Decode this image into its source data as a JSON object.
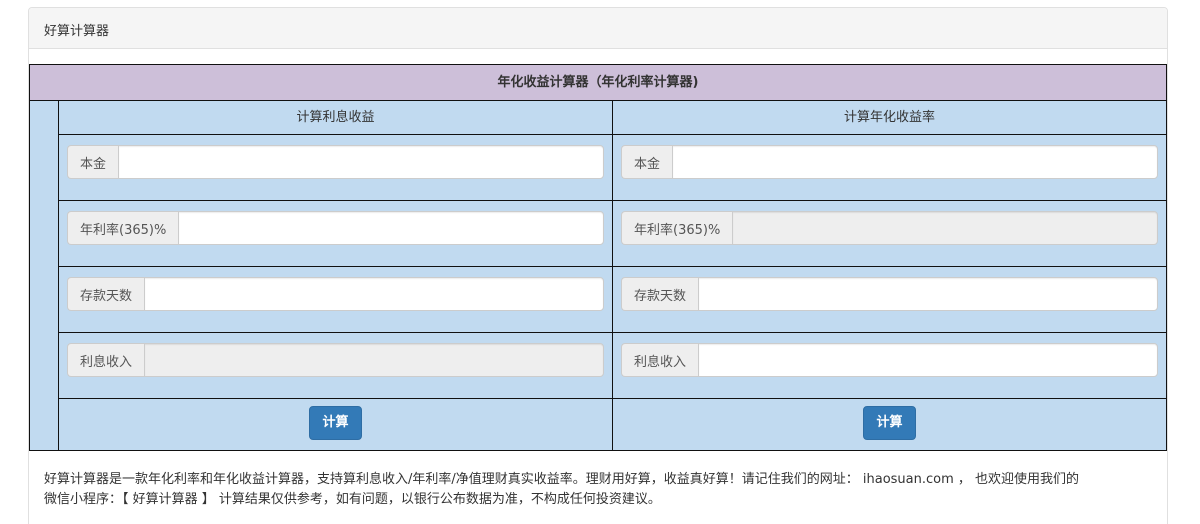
{
  "panel": {
    "title": "好算计算器"
  },
  "calculator": {
    "title": "年化收益计算器（年化利率计算器)",
    "left": {
      "heading": "计算利息收益",
      "fields": [
        {
          "label": "本金",
          "value": "",
          "readonly": false
        },
        {
          "label": "年利率(365)%",
          "value": "",
          "readonly": false
        },
        {
          "label": "存款天数",
          "value": "",
          "readonly": false
        },
        {
          "label": "利息收入",
          "value": "",
          "readonly": true
        }
      ],
      "button": "计算"
    },
    "right": {
      "heading": "计算年化收益率",
      "fields": [
        {
          "label": "本金",
          "value": "",
          "readonly": false
        },
        {
          "label": "年利率(365)%",
          "value": "",
          "readonly": true
        },
        {
          "label": "存款天数",
          "value": "",
          "readonly": false
        },
        {
          "label": "利息收入",
          "value": "",
          "readonly": false
        }
      ],
      "button": "计算"
    }
  },
  "description": {
    "line1": "好算计算器是一款年化利率和年化收益计算器，支持算利息收入/年利率/净值理财真实收益率。理财用好算，收益真好算！请记住我们的网址： ihaosuan.com ， 也欢迎使用我们的",
    "line2": "微信小程序：【 好算计算器 】 计算结果仅供参考，如有问题，以银行公布数据为准，不构成任何投资建议。"
  }
}
